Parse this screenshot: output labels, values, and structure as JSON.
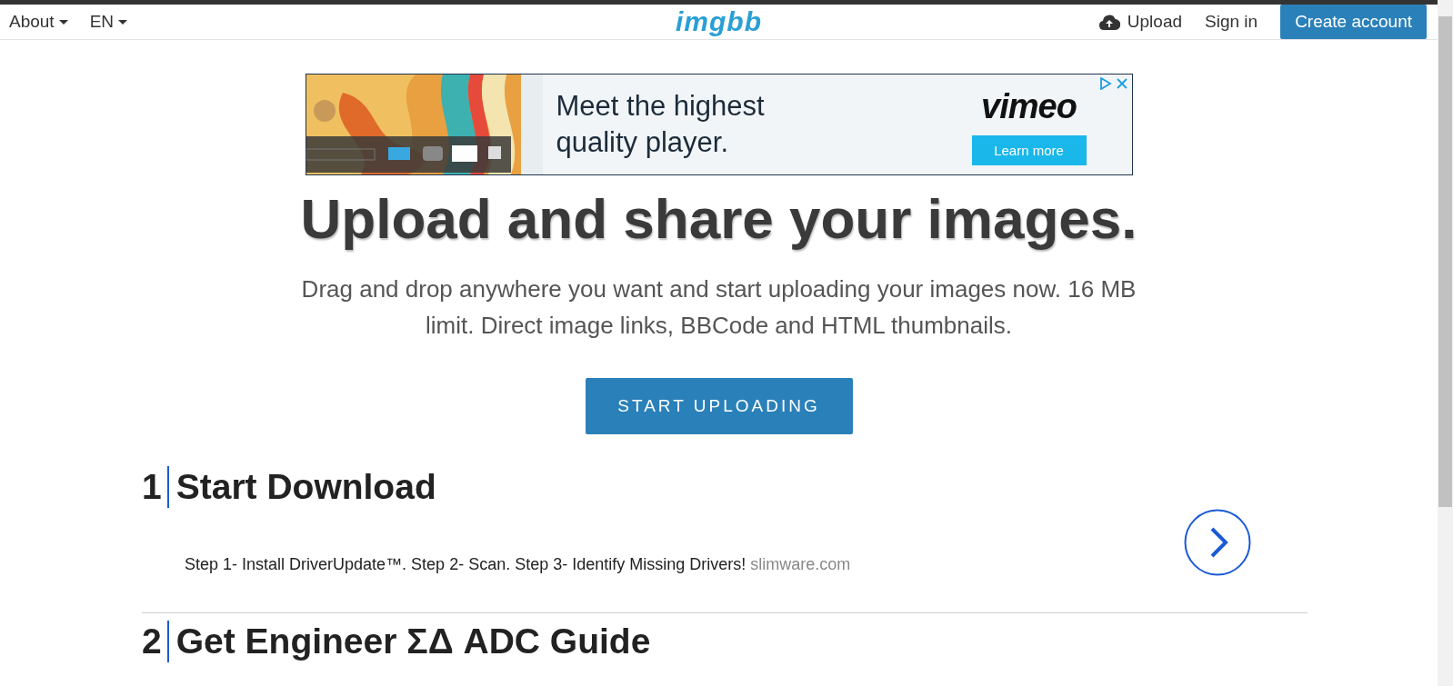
{
  "header": {
    "nav": [
      {
        "label": "About",
        "dropdown": true
      },
      {
        "label": "EN",
        "dropdown": true
      }
    ],
    "logo": "imgbb",
    "upload": "Upload",
    "sign_in": "Sign in",
    "create_account": "Create account"
  },
  "ad_banner": {
    "headline_lines": [
      "Meet the highest",
      "quality player."
    ],
    "brand": "vimeo",
    "cta": "Learn more"
  },
  "hero": {
    "title": "Upload and share your images.",
    "subtitle": "Drag and drop anywhere you want and start uploading your images now. 16 MB limit. Direct image links, BBCode and HTML thumbnails.",
    "button": "START UPLOADING"
  },
  "ad_list": [
    {
      "number": "1",
      "title": "Start Download",
      "text": "Step 1- Install DriverUpdate™. Step 2- Scan. Step 3- Identify Missing Drivers!",
      "domain": "slimware.com"
    },
    {
      "number": "2",
      "title": "Get Engineer ΣΔ ADC Guide"
    }
  ]
}
